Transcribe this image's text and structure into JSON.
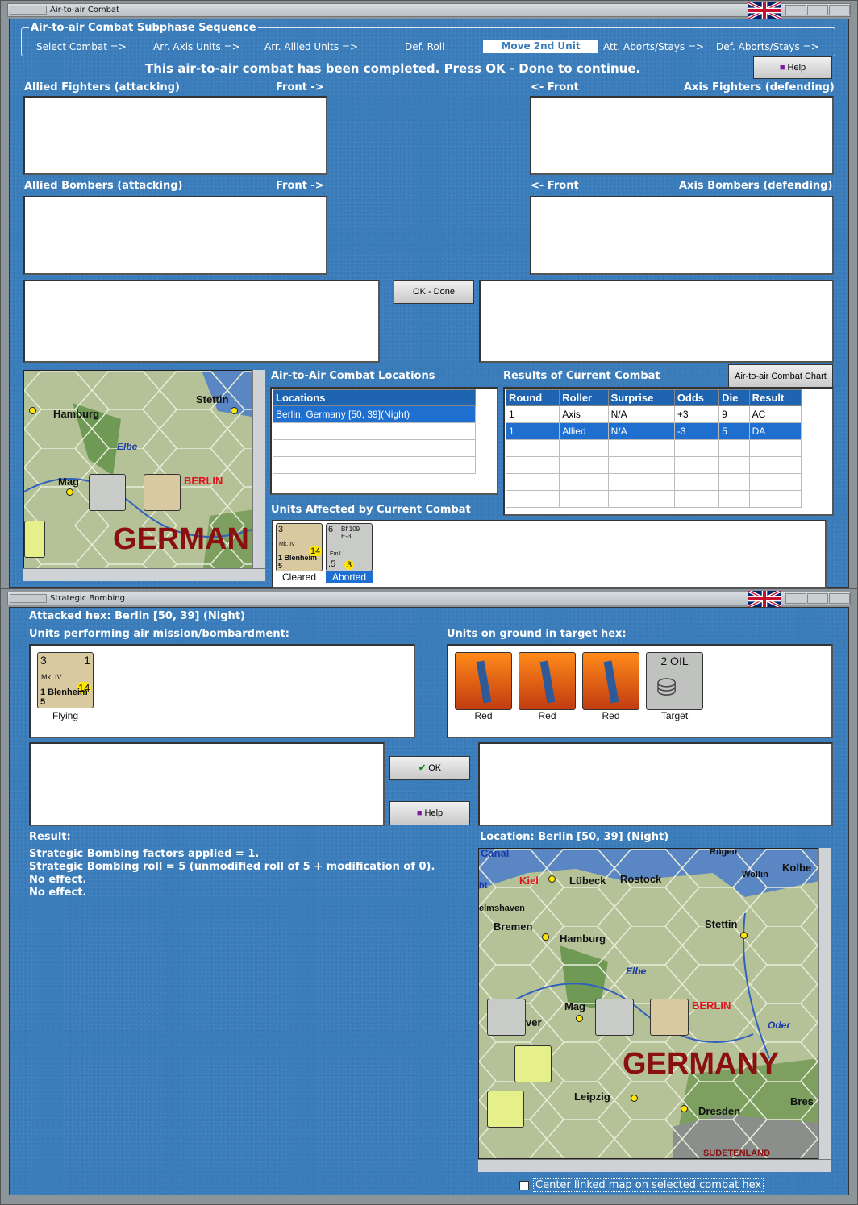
{
  "window1": {
    "title": "Air-to-air Combat",
    "sequence_legend": "Air-to-air Combat Subphase Sequence",
    "sequence": [
      "Select Combat =>",
      "Arr. Axis Units =>",
      "Arr. Allied Units =>",
      "Def. Roll",
      "Move 2nd Unit",
      "Att. Aborts/Stays =>",
      "Def. Aborts/Stays =>"
    ],
    "status_message": "This air-to-air combat has been completed.  Press OK - Done to continue.",
    "help_label": "Help",
    "allied_fighters_label": "Allied Fighters (attacking)",
    "front_right": "Front ->",
    "front_left": "<- Front",
    "axis_fighters_label": "Axis Fighters (defending)",
    "allied_bombers_label": "Allied Bombers (attacking)",
    "axis_bombers_label": "Axis Bombers (defending)",
    "ok_done_label": "OK - Done",
    "locations_title": "Air-to-Air Combat Locations",
    "locations_header": "Locations",
    "locations": [
      "Berlin, Germany [50, 39](Night)"
    ],
    "results_title": "Results of Current Combat",
    "chart_button": "Air-to-air Combat Chart",
    "results_headers": [
      "Round",
      "Roller",
      "Surprise",
      "Odds",
      "Die",
      "Result"
    ],
    "results_rows": [
      [
        "1",
        "Axis",
        "N/A",
        "+3",
        "9",
        "AC"
      ],
      [
        "1",
        "Allied",
        "N/A",
        "-3",
        "5",
        "DA"
      ]
    ],
    "affected_title": "Units Affected by Current Combat",
    "affected_units": [
      {
        "caption": "Cleared",
        "top_left": "3",
        "name": "Mk. IV",
        "value": "14",
        "bottom": "1 Blenheim 5"
      },
      {
        "caption": "Aborted",
        "top_left": "6",
        "name": "Bf 109 E-3",
        "sub": "Emil",
        "value": "3",
        "bottom": ".5"
      }
    ]
  },
  "window2": {
    "title": "Strategic Bombing",
    "attacked_hex": "Attacked hex: Berlin  [50, 39] (Night)",
    "units_performing_label": "Units performing air mission/bombardment:",
    "units_ground_label": "Units on ground in target hex:",
    "flying_unit": {
      "caption": "Flying",
      "top_left": "3",
      "top_right": "1",
      "name": "Mk. IV",
      "value": "14",
      "bottom": "1 Blenheim 5"
    },
    "ground_units": [
      {
        "caption": "Red"
      },
      {
        "caption": "Red"
      },
      {
        "caption": "Red"
      },
      {
        "caption": "Target",
        "label": "2 OIL"
      }
    ],
    "ok_label": "OK",
    "help_label": "Help",
    "result_label": "Result:",
    "result_lines": [
      "Strategic Bombing factors applied = 1.",
      "Strategic Bombing roll = 5 (unmodified roll of 5 + modification of 0).",
      "No effect.",
      "No effect."
    ],
    "location_label": "Location:  Berlin  [50, 39] (Night)",
    "center_checkbox": "Center linked map on selected combat hex"
  },
  "map_small": {
    "cities": [
      "Hamburg",
      "Stettin",
      "Elbe",
      "Mag",
      "BERLIN",
      "GERMAN"
    ]
  },
  "map_large": {
    "cities": [
      "Canal",
      "Rügen",
      "Kiel",
      "Lübeck",
      "Rostock",
      "Wollin",
      "Kolbe",
      "elmshaven",
      "Bremen",
      "Hamburg",
      "Stettin",
      "Elbe",
      "Mag",
      "BERLIN",
      "Oder",
      "GERMANY",
      "Leipzig",
      "Dresden",
      "Bres",
      "SUDETENLAND",
      "ht",
      "ver"
    ]
  },
  "colors": {
    "panel_blue": "#3b7dbb",
    "select_blue": "#1f6fd0",
    "berlin_red": "#e0141e",
    "germany_red": "#8a1010"
  }
}
